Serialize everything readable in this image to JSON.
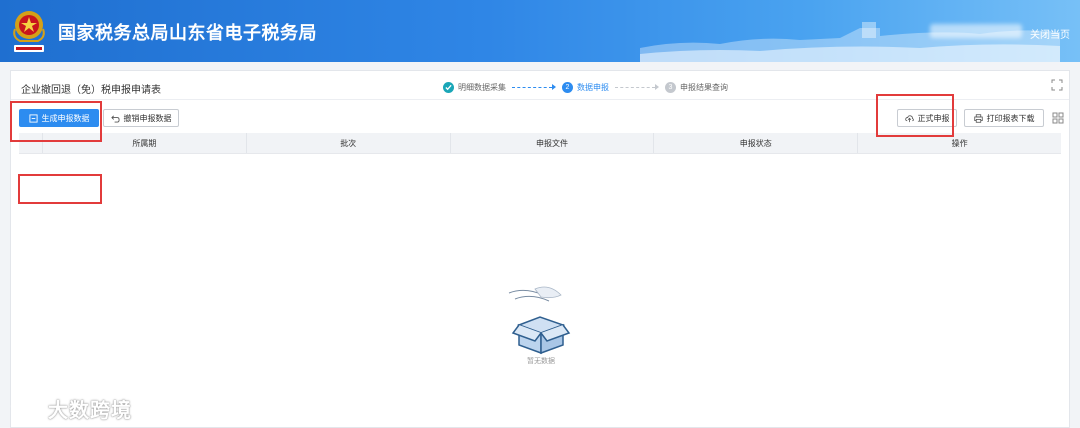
{
  "header": {
    "site_title": "国家税务总局山东省电子税务局",
    "close_page": "关闭当页",
    "emblem_icon": "tax-emblem-icon"
  },
  "form": {
    "title": "企业撤回退（免）税申报申请表"
  },
  "steps": [
    {
      "label": "明细数据采集",
      "status": "done",
      "index": "1"
    },
    {
      "label": "数据申报",
      "status": "active",
      "index": "2"
    },
    {
      "label": "申报结果查询",
      "status": "todo",
      "index": "3"
    }
  ],
  "toolbar": {
    "generate_label": "生成申报数据",
    "revoke_label": "撤销申报数据",
    "submit_label": "正式申报",
    "print_label": "打印报表下载"
  },
  "table": {
    "columns": [
      "所属期",
      "批次",
      "申报文件",
      "申报状态",
      "操作"
    ],
    "rows": []
  },
  "empty": {
    "text": "暂无数据",
    "icon": "empty-box-icon"
  },
  "watermark": {
    "text": "大数跨境"
  },
  "colors": {
    "header_gradient_start": "#1f6fd0",
    "primary": "#2d8cf0",
    "step_done": "#1aa6b7",
    "highlight": "#e23b3b"
  }
}
